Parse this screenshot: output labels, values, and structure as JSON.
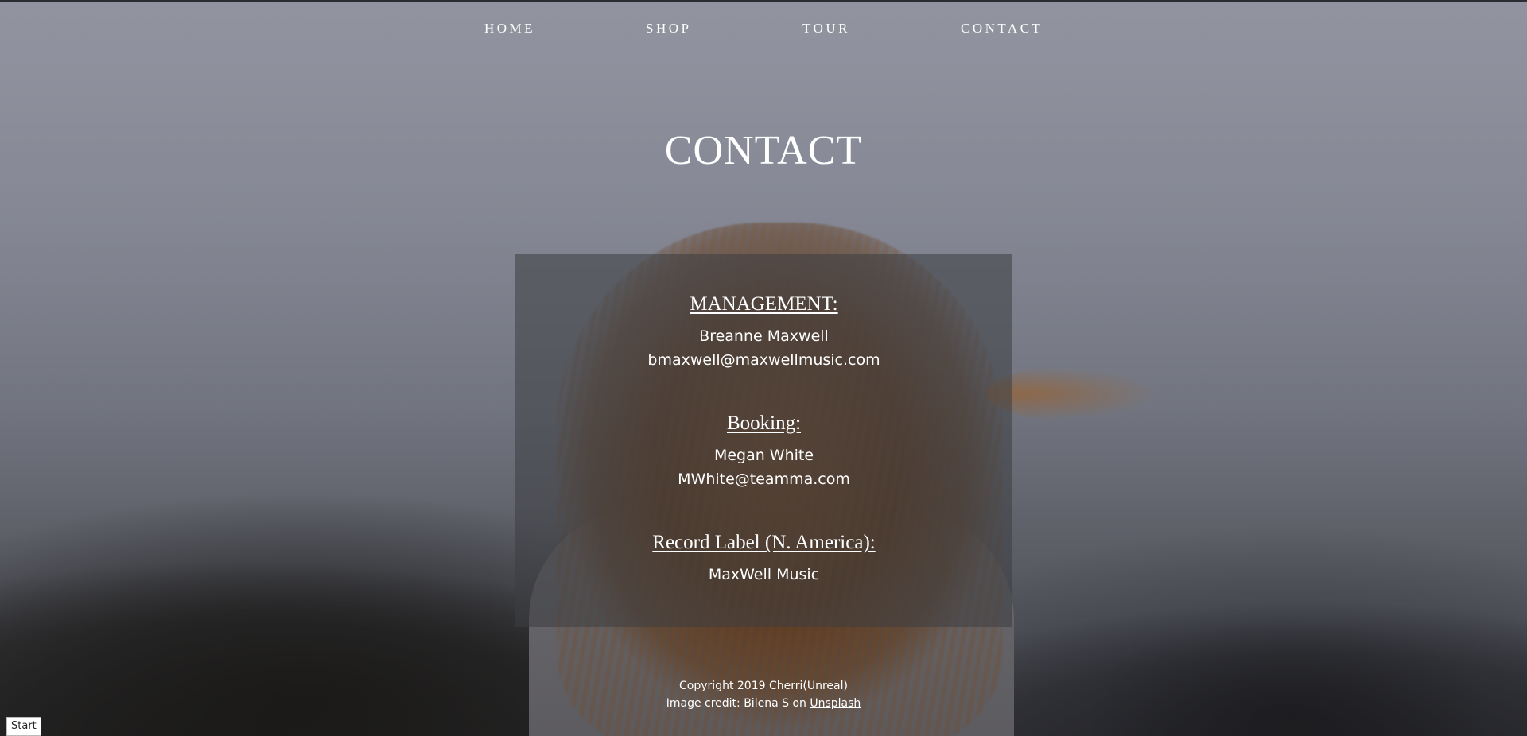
{
  "nav": {
    "items": [
      {
        "label": "HOME"
      },
      {
        "label": "SHOP"
      },
      {
        "label": "TOUR"
      },
      {
        "label": "CONTACT"
      }
    ]
  },
  "page": {
    "title": "CONTACT"
  },
  "contacts": {
    "management": {
      "heading": "MANAGEMENT:",
      "name": "Breanne Maxwell",
      "email": "bmaxwell@maxwellmusic.com"
    },
    "booking": {
      "heading": "Booking:",
      "name": "Megan White",
      "email": "MWhite@teamma.com"
    },
    "record_label": {
      "heading": "Record Label (N. America):",
      "name": "MaxWell Music"
    }
  },
  "footer": {
    "copyright": "Copyright 2019 Cherri(Unreal)",
    "credit_prefix": "Image credit: Bilena S on ",
    "credit_link": "Unsplash"
  },
  "start_button": {
    "label": "Start"
  }
}
